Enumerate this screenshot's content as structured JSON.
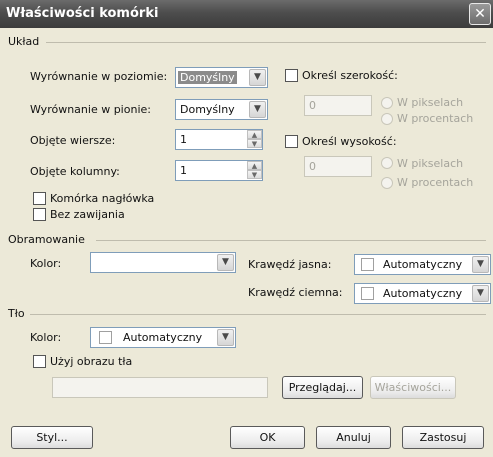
{
  "title": "Właściwości komórki",
  "layout_section": {
    "label": "Układ",
    "halign_label": "Wyrównanie w poziomie:",
    "halign_value": "Domyślny",
    "valign_label": "Wyrównanie w pionie:",
    "valign_value": "Domyślny",
    "rowspan_label": "Objęte wiersze:",
    "rowspan_value": "1",
    "colspan_label": "Objęte kolumny:",
    "colspan_value": "1",
    "width_check_label": "Określ szerokość:",
    "width_value": "0",
    "width_pixels": "W pikselach",
    "width_percent": "W procentach",
    "height_check_label": "Określ wysokość:",
    "height_value": "0",
    "height_pixels": "W pikselach",
    "height_percent": "W procentach",
    "header_cell": "Komórka nagłówka",
    "no_wrap": "Bez zawijania"
  },
  "borders_section": {
    "label": "Obramowanie",
    "color_label": "Kolor:",
    "color_value": "",
    "light_label": "Krawędź jasna:",
    "light_value": "Automatyczny",
    "dark_label": "Krawędź ciemna:",
    "dark_value": "Automatyczny"
  },
  "background_section": {
    "label": "Tło",
    "color_label": "Kolor:",
    "color_value": "Automatyczny",
    "use_image": "Użyj obrazu tła",
    "image_path": "",
    "browse": "Przeglądaj...",
    "properties": "Właściwości..."
  },
  "buttons": {
    "style": "Styl...",
    "ok": "OK",
    "cancel": "Anuluj",
    "apply": "Zastosuj"
  }
}
